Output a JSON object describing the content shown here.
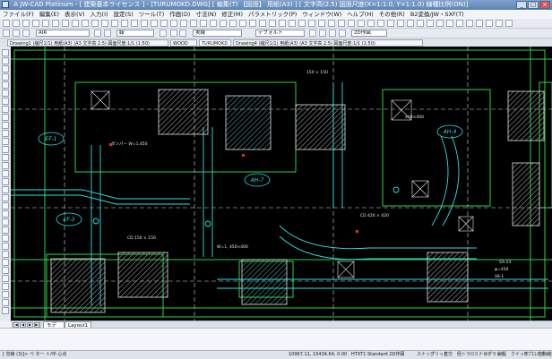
{
  "window": {
    "title": "A JW-CAD Platinum - [ 建築基本ライセンス ] - [TURUMOKD.DWG] [ 編集(T) 【図面】 用紙(A3) ] [ 文字高(2.5) 図面尺度(X=1:1.0, Y=1:1.0) 線種比例(ON)]",
    "minimize": "_",
    "maximize": "□",
    "close": "×"
  },
  "menu": {
    "items": [
      "ファイル(F)",
      "編集(E)",
      "表示(V)",
      "入力(I)",
      "設定(S)",
      "ツール(T)",
      "作画(D)",
      "寸法(N)",
      "修正(M)",
      "パラメトリック(P)",
      "ウィンドウ(W)",
      "ヘルプ(H)",
      "その他(R)",
      "B2変換/JW・SXF(T)"
    ]
  },
  "toolbar": {
    "layer_value": "AIR",
    "color_value": "緑",
    "linetype_value": "実線",
    "lineweight_value": "デフォルト",
    "view_value": "2D作図"
  },
  "doc_tabs": [
    "Drawing1 (縮尺1/1) 用紙(A3) (A3 文字高 2.5) 図面尺度:1/1 (1:50)",
    "WOOD",
    "TURUMOKD",
    "Drawing4 (縮尺1/1) 用紙(A3) (A3 文字高 2.5) 図面尺度:1/1 (1:50)"
  ],
  "canvas": {
    "room_labels": [
      "EF-1",
      "AH-7",
      "EF-3",
      "AH-4"
    ],
    "dims": [
      "400×400",
      "W=1, 450×400",
      "φ=450",
      "VA-1",
      "SA-14"
    ],
    "notes": [
      "ダンパー W=1,450",
      "CD 420 × 420",
      "CD 150 × 150",
      "150 × 150"
    ]
  },
  "sheets": {
    "nav": [
      "|◀",
      "◀",
      "▶",
      "▶|"
    ],
    "tabs": [
      "モデル",
      "Layout1"
    ]
  },
  "command": {
    "prompt": ""
  },
  "status": {
    "left": "[ 交線 (3)]> ベ ター ト/中 心点",
    "coords": "10967.11, 15434.64, 0.00",
    "mode": "HTXT1  Standard  2D作図",
    "toggles": [
      "スナップ",
      "グリッド",
      "直交",
      "極トラ",
      "Oスナップ",
      "Oトラック",
      "線幅",
      "クイック",
      "Bプロパティ",
      "自動補完"
    ]
  },
  "colors": {
    "canvas_bg": "#000000",
    "wall_green": "#2bd24a",
    "pipe_cyan": "#2fe0e8",
    "text_white": "#e8e8e8",
    "hatch_gray": "#9a9a9a"
  }
}
